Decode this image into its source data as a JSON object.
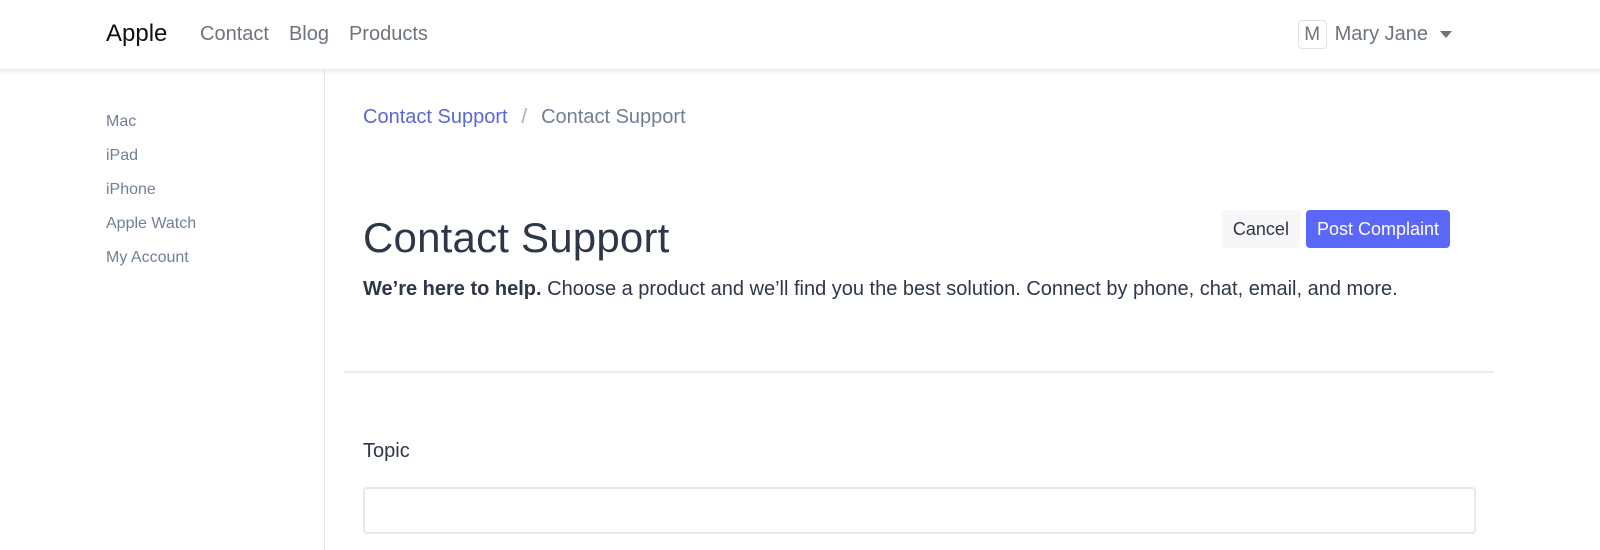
{
  "header": {
    "brand": "Apple",
    "nav": [
      "Contact",
      "Blog",
      "Products"
    ],
    "user": {
      "initial": "M",
      "name": "Mary Jane",
      "caret_icon": "caret-down-icon"
    }
  },
  "sidebar": {
    "items": [
      {
        "label": "Mac"
      },
      {
        "label": "iPad"
      },
      {
        "label": "iPhone"
      },
      {
        "label": "Apple Watch"
      },
      {
        "label": "My Account"
      }
    ]
  },
  "breadcrumb": {
    "link": "Contact Support",
    "separator": "/",
    "current": "Contact Support"
  },
  "page": {
    "title": "Contact Support",
    "lead_bold": "We’re here to help.",
    "lead_rest": " Choose a product and we’ll find you the best solution. Connect by phone, chat, email, and more."
  },
  "actions": {
    "cancel": "Cancel",
    "post": "Post Complaint"
  },
  "form": {
    "topic_label": "Topic",
    "topic_value": ""
  },
  "colors": {
    "accent": "#5a67f8",
    "link": "#5a67d8",
    "text": "#2d3748",
    "muted": "#718096"
  }
}
